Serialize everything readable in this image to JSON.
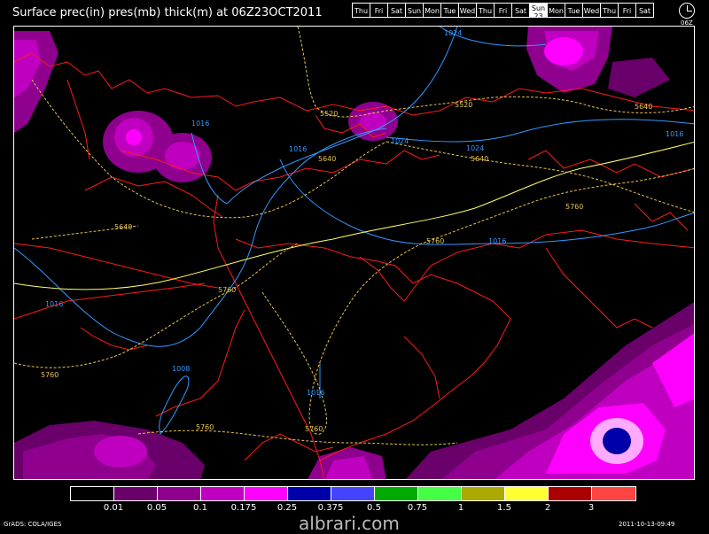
{
  "header": {
    "title": "Surface prec(in) pres(mb) thick(m) at 06Z23OCT2011",
    "days": [
      "Thu",
      "Fri",
      "Sat",
      "Sun",
      "Mon",
      "Tue",
      "Wed",
      "Thu",
      "Fri",
      "Sat",
      "Sun",
      "Mon",
      "Tue",
      "Wed",
      "Thu",
      "Fri",
      "Sat"
    ],
    "active_day_index": 10,
    "active_day_number": "23",
    "time_label": "06Z"
  },
  "map": {
    "isobar_color": "#3399ff",
    "thickness_color": "#e6c34d",
    "thickness_5640_color": "#ffff66",
    "coast_color": "#ff1a1a",
    "isobar_labels": [
      "1024",
      "1016",
      "1016",
      "1024",
      "1024",
      "1016",
      "1016",
      "1016",
      "1008",
      "1016"
    ],
    "thickness_labels": [
      "5520",
      "5520",
      "5640",
      "5640",
      "5640",
      "5640",
      "5760",
      "5760",
      "5760",
      "5760",
      "5760",
      "5760"
    ]
  },
  "legend": {
    "colors": [
      "#000000",
      "#6a006a",
      "#8f008f",
      "#c000c0",
      "#ff00ff",
      "#0000aa",
      "#4444ff",
      "#00aa00",
      "#44ff44",
      "#aaaa00",
      "#ffff33",
      "#aa0000",
      "#ff4444"
    ],
    "labels": [
      "0.01",
      "0.05",
      "0.1",
      "0.175",
      "0.25",
      "0.375",
      "0.5",
      "0.75",
      "1",
      "1.5",
      "2",
      "3"
    ]
  },
  "footer": {
    "left": "GrADS: COLA/IGES",
    "right": "2011-10-13-09:49",
    "watermark": "albrari.com"
  }
}
